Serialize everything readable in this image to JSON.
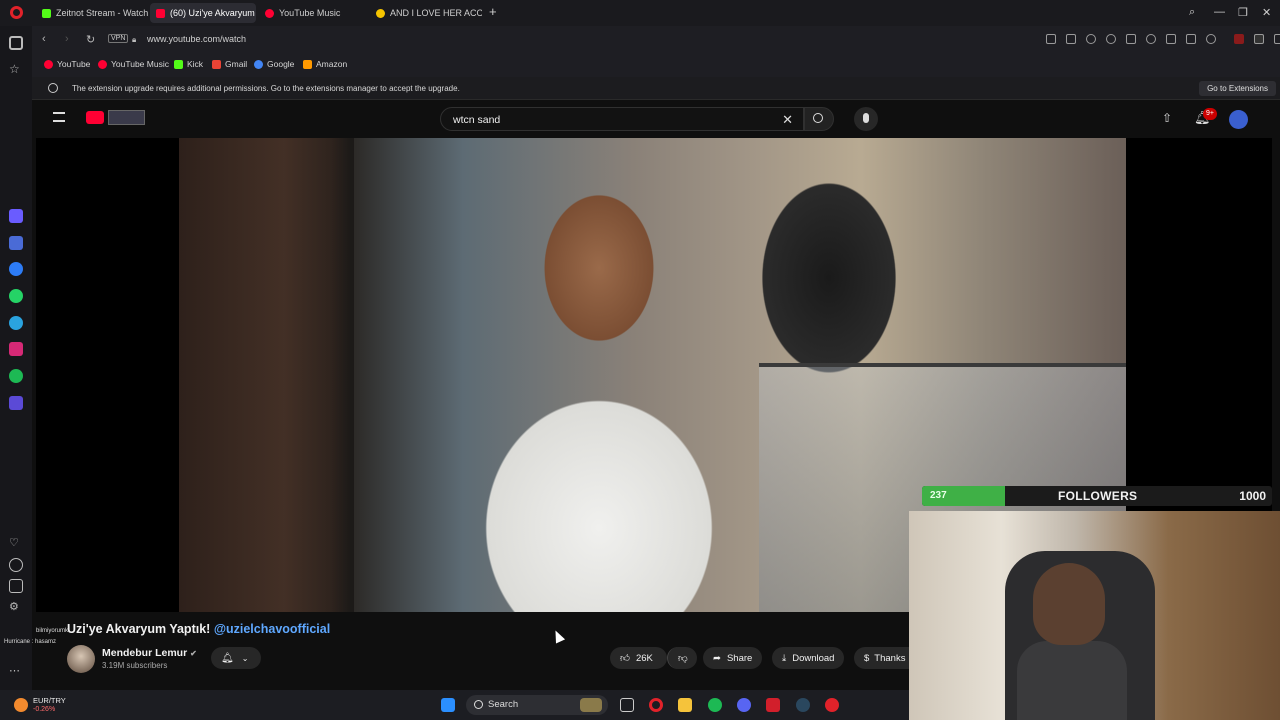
{
  "browser": {
    "tabs": [
      {
        "label": "Zeitnot Stream - Watch Li",
        "color": "#53fc18"
      },
      {
        "label": "(60) Uzi'ye Akvaryum",
        "color": "#ff0033"
      },
      {
        "label": "YouTube Music",
        "color": "#ff0033"
      },
      {
        "label": "AND I LOVE HER ACOUST",
        "color": "#f5c400"
      }
    ],
    "new_tab": "+",
    "vpn_label": "VPN",
    "url": "www.youtube.com/watch",
    "bookmarks": [
      {
        "label": "YouTube",
        "color": "#ff0033"
      },
      {
        "label": "YouTube Music",
        "color": "#ff0033"
      },
      {
        "label": "Kick",
        "color": "#53fc18"
      },
      {
        "label": "Gmail",
        "color": "#ea4335"
      },
      {
        "label": "Google",
        "color": "#4285f4"
      },
      {
        "label": "Amazon",
        "color": "#ff9900"
      }
    ],
    "notice": {
      "message": "The extension upgrade requires additional permissions. Go to the extensions manager to accept the upgrade.",
      "button": "Go to Extensions"
    }
  },
  "youtube": {
    "search_value": "wtcn sand",
    "notifications_badge": "9+",
    "video": {
      "title_main": "Uzi'ye Akvaryum Yaptık!",
      "title_tag": "@uzielchavoofficial"
    },
    "channel": {
      "name": "Mendebur Lemur",
      "verified_mark": "✔",
      "subscribers": "3.19M subscribers"
    },
    "actions": {
      "likes": "26K",
      "share": "Share",
      "download": "Download",
      "thanks": "Thanks"
    }
  },
  "overlay": {
    "followers_current": "237",
    "followers_label": "FOLLOWERS",
    "followers_goal": "1000",
    "followers_progress": 0.237
  },
  "chat_overlay": {
    "line1": "bilmiyorumki",
    "line2": "Hurricane : hasamz"
  },
  "taskbar": {
    "search_label": "Search",
    "ticker_symbol": "EUR/TRY",
    "ticker_change": "-0.26%"
  },
  "colors": {
    "accent_red": "#ff0033",
    "followers_green": "#3fb046",
    "link_blue": "#5fa8ff"
  }
}
